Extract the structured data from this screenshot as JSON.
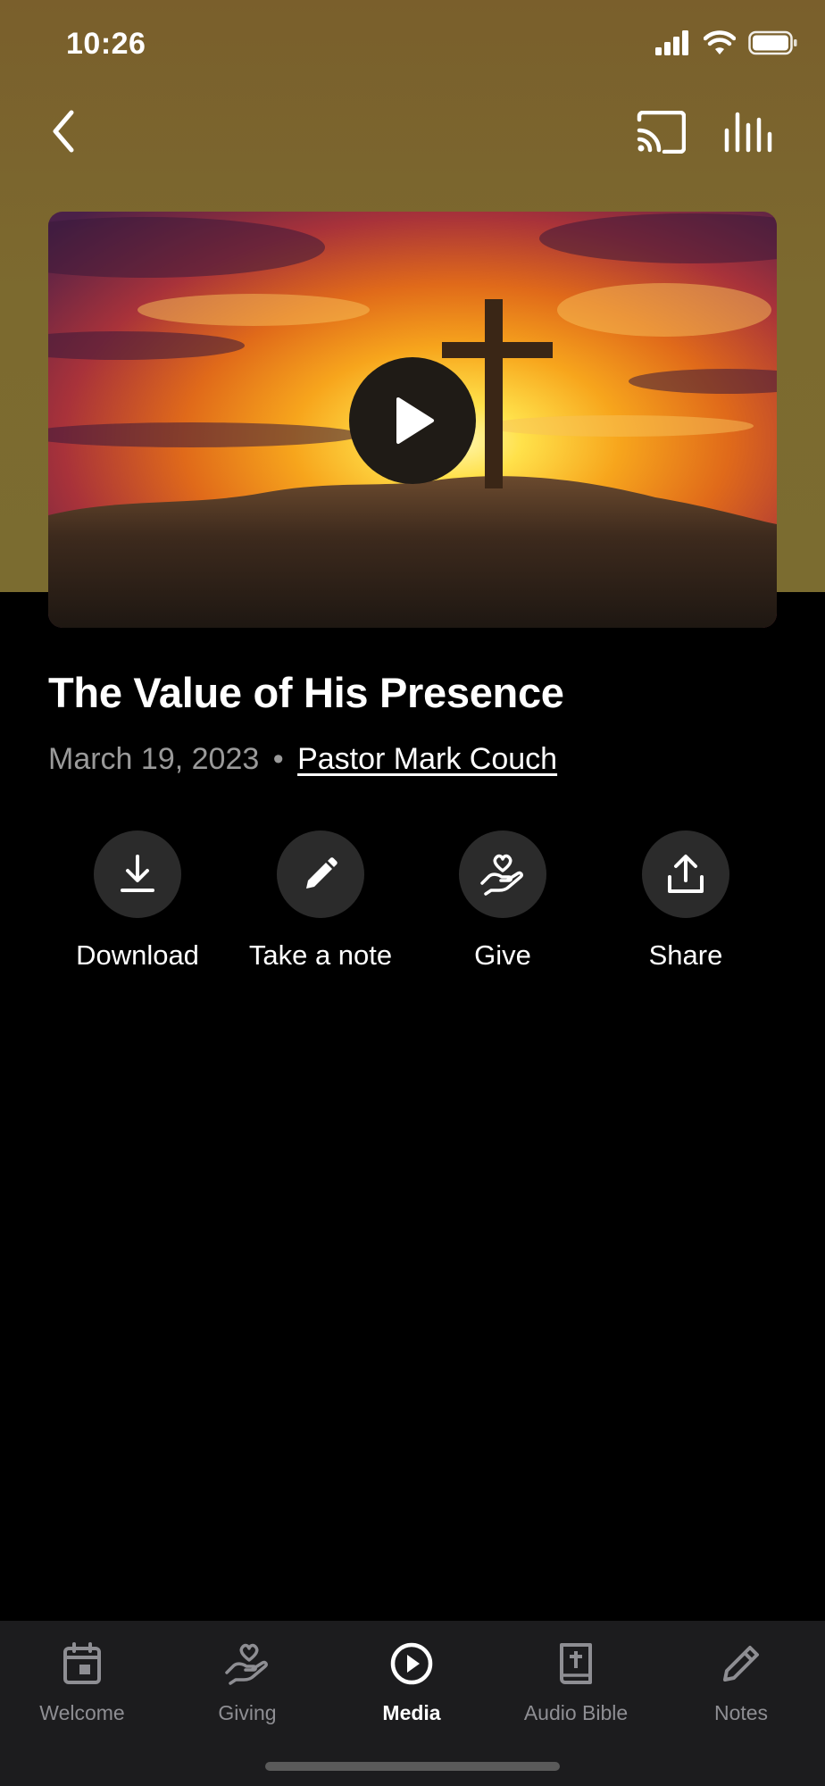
{
  "status": {
    "time": "10:26"
  },
  "nav": {
    "back": "back-icon",
    "cast": "cast-icon",
    "equalizer": "equalizer-icon"
  },
  "media": {
    "artwork": "cross-on-hill-at-sunset",
    "title": "The Value of His Presence",
    "date": "March 19, 2023",
    "separator": "•",
    "speaker": "Pastor Mark Couch"
  },
  "actions": [
    {
      "label": "Download",
      "icon": "download-icon"
    },
    {
      "label": "Take a note",
      "icon": "pencil-icon"
    },
    {
      "label": "Give",
      "icon": "giving-hand-icon"
    },
    {
      "label": "Share",
      "icon": "share-icon"
    }
  ],
  "tabs": [
    {
      "label": "Welcome",
      "icon": "calendar-icon",
      "active": false
    },
    {
      "label": "Giving",
      "icon": "giving-hand-icon",
      "active": false
    },
    {
      "label": "Media",
      "icon": "play-circle-icon",
      "active": true
    },
    {
      "label": "Audio Bible",
      "icon": "bible-icon",
      "active": false
    },
    {
      "label": "Notes",
      "icon": "pencil-icon",
      "active": false
    }
  ],
  "colors": {
    "header": "#7b6a2f",
    "background": "#000000",
    "tabbar": "#1c1c1e",
    "inactive_tab": "#8e8e93"
  }
}
